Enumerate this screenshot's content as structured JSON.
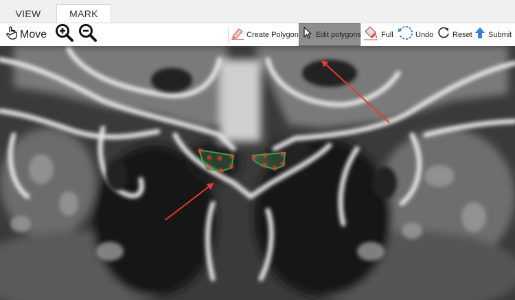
{
  "tabs": [
    {
      "label": "VIEW",
      "active": false
    },
    {
      "label": "MARK",
      "active": true
    }
  ],
  "toolbar": {
    "move_label": "Move",
    "create_polygons_label": "Create Polygons",
    "edit_polygons_label": "Edit polygons",
    "full_label": "Full",
    "undo_label": "Undo",
    "reset_label": "Reset",
    "submit_label": "Submit"
  },
  "colors": {
    "active_tool_bg": "#8e8e8e",
    "polygon_outline": "#2fa84f",
    "polygon_vertex": "#e8452e",
    "annotation_arrow": "#e53935",
    "submit_icon": "#3a7fd8"
  }
}
